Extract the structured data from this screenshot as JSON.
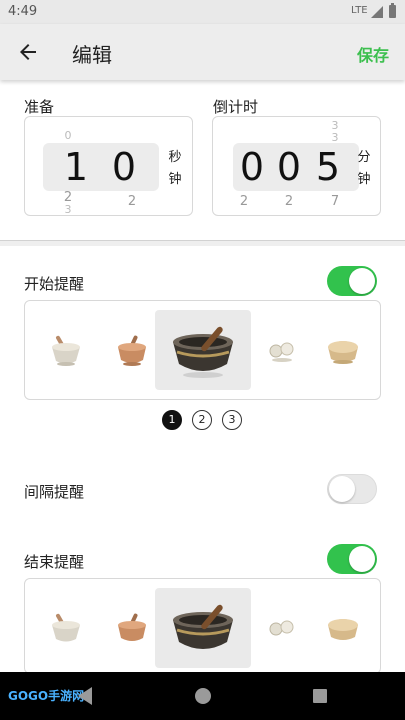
{
  "status_bar": {
    "time": "4:49",
    "network": "LTE"
  },
  "app_bar": {
    "title": "编辑",
    "save_label": "保存"
  },
  "prep": {
    "label": "准备",
    "digits": [
      "1",
      "0"
    ],
    "above": [
      "0",
      ""
    ],
    "below": [
      "2",
      "2"
    ],
    "below2": [
      "3",
      ""
    ],
    "unit_chars": [
      "秒",
      "钟"
    ]
  },
  "countdown": {
    "label": "倒计时",
    "digits": [
      "0",
      "0",
      "5"
    ],
    "above": [
      "",
      "",
      "3"
    ],
    "below": [
      "2",
      "2",
      "7"
    ],
    "above_top": [
      "",
      "",
      "3"
    ],
    "unit_chars": [
      "分",
      "钟"
    ]
  },
  "start_reminder": {
    "label": "开始提醒",
    "enabled": true
  },
  "interval_reminder": {
    "label": "间隔提醒",
    "enabled": false
  },
  "end_reminder": {
    "label": "结束提醒",
    "enabled": true
  },
  "pagination": {
    "pages": [
      "1",
      "2",
      "3"
    ],
    "active": 1
  },
  "watermark": "GOGO手游网",
  "colors": {
    "accent": "#32c24d",
    "save_text": "#3cbf4e"
  }
}
